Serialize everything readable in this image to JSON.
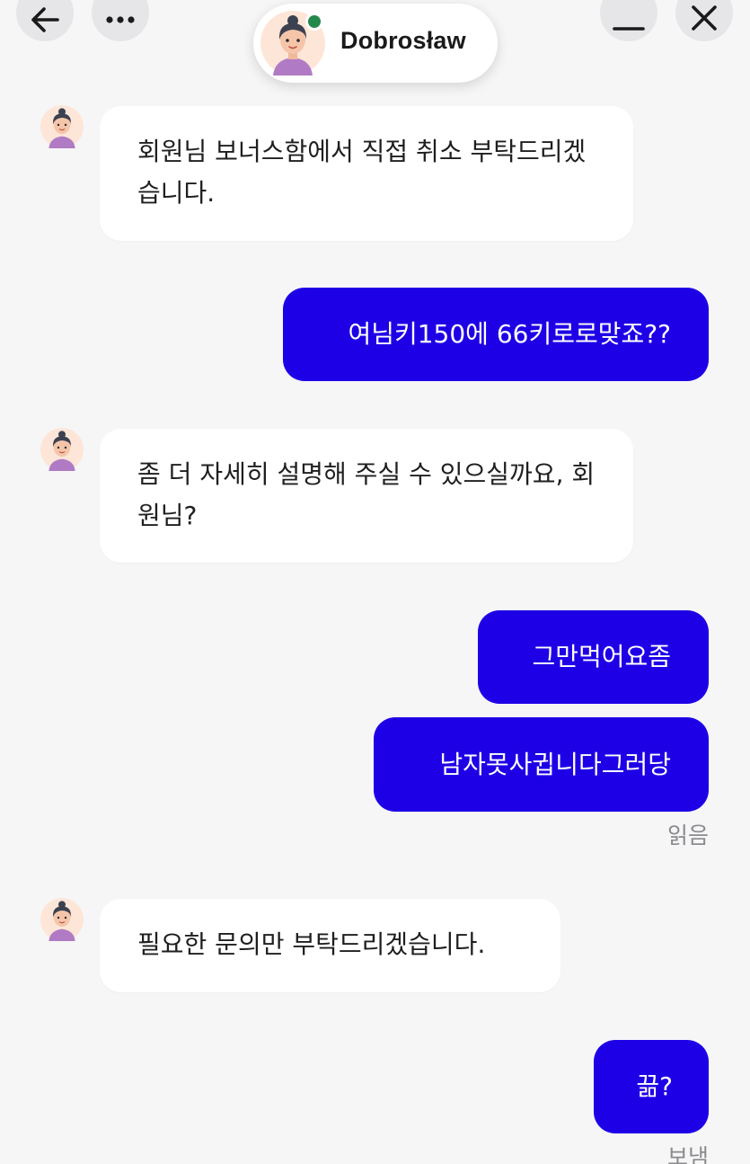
{
  "header": {
    "back_icon": "arrow-left-icon",
    "more_icon": "more-horizontal-icon",
    "minimize_icon": "minimize-icon",
    "close_icon": "close-icon",
    "agent_name": "Dobrosław",
    "online_status_color": "#23894b"
  },
  "colors": {
    "user_bubble": "#1e00e6",
    "agent_bubble": "#ffffff",
    "background": "#f6f6f7"
  },
  "messages": [
    {
      "sender": "agent",
      "text": "회원님 보너스함에서 직접 취소 부탁드리겠습니다."
    },
    {
      "sender": "user",
      "text": "여님키150에 66키로로맞죠??"
    },
    {
      "sender": "agent",
      "text": "좀 더 자세히 설명해 주실 수 있으실까요, 회원님?"
    },
    {
      "sender": "user",
      "text": "그만먹어요좀"
    },
    {
      "sender": "user",
      "text": "남자못사귑니다그러당",
      "status": "읽음"
    },
    {
      "sender": "agent",
      "text": "필요한 문의만 부탁드리겠습니다."
    },
    {
      "sender": "user",
      "text": "끎?",
      "status": "보냄"
    }
  ]
}
